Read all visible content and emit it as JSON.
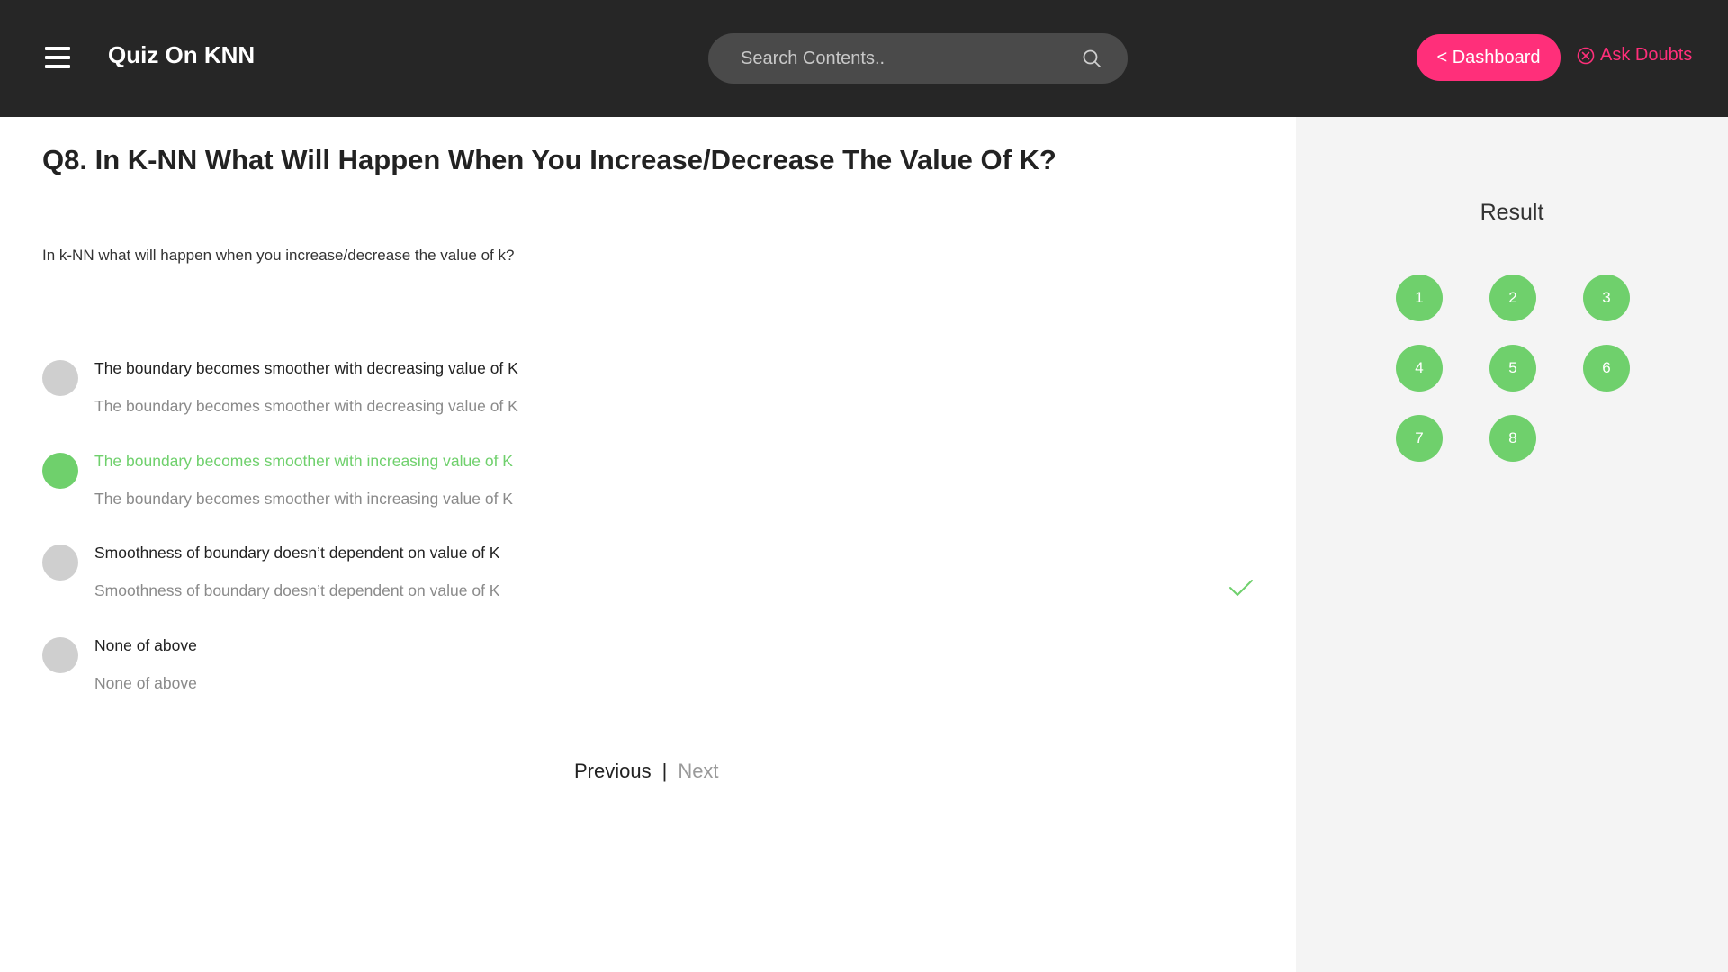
{
  "header": {
    "title": "Quiz On KNN",
    "search_placeholder": "Search Contents..",
    "dashboard_label": "< Dashboard",
    "ask_doubts_label": "Ask Doubts",
    "menu_icon": "hamburger-icon",
    "search_icon": "search-icon",
    "ask_icon": "close-circle-icon"
  },
  "question": {
    "title": "Q8. In K-NN What Will Happen When You Increase/Decrease The Value Of K?",
    "text": "In k-NN what will happen when you increase/decrease the value of k?",
    "options": [
      {
        "label": "The boundary becomes smoother with decreasing value of K",
        "sub": "The boundary becomes smoother with decreasing value of K",
        "correct": false
      },
      {
        "label": "The boundary becomes smoother with increasing value of K",
        "sub": "The boundary becomes smoother with increasing value of K",
        "correct": true
      },
      {
        "label": "Smoothness of boundary doesn’t dependent on value of K",
        "sub": "Smoothness of boundary doesn’t dependent on value of K",
        "correct": false
      },
      {
        "label": "None of above",
        "sub": "None of above",
        "correct": false
      }
    ]
  },
  "pager": {
    "previous": "Previous",
    "separator": "|",
    "next": "Next"
  },
  "sidebar": {
    "title": "Result",
    "numbers": [
      "1",
      "2",
      "3",
      "4",
      "5",
      "6",
      "7",
      "8"
    ]
  },
  "colors": {
    "header_bg": "#262626",
    "accent_pink": "#ff2f7a",
    "correct_green": "#6fd06c",
    "sidebar_bg": "#f4f4f4"
  }
}
